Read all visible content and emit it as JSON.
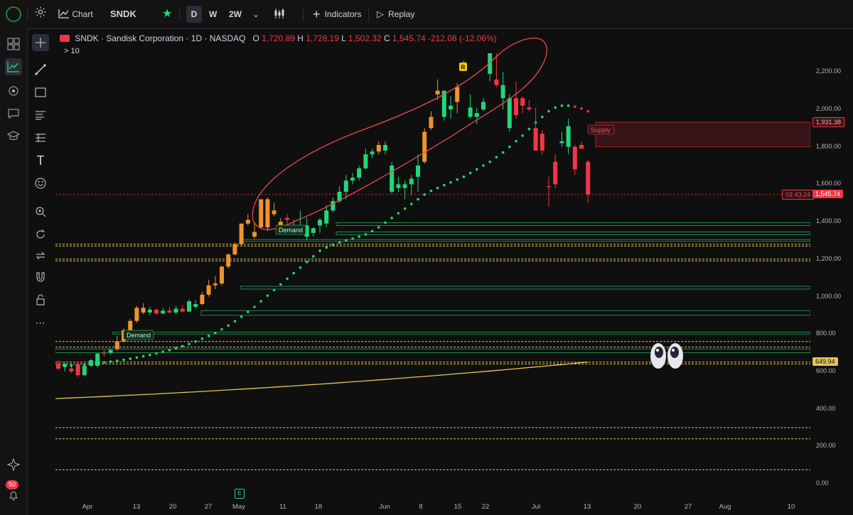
{
  "topbar": {
    "chart_label": "Chart",
    "symbol": "SNDK",
    "intervals": [
      "D",
      "W",
      "2W"
    ],
    "indicators_label": "Indicators",
    "replay_label": "Replay"
  },
  "legend": {
    "symbol": "SNDK",
    "name": "Sandisk Corporation · 1D · NASDAQ",
    "open_label": "O",
    "open": "1,720.89",
    "high_label": "H",
    "high": "1,728.19",
    "low_label": "L",
    "low": "1,502.32",
    "close_label": "C",
    "close": "1,545.74",
    "change": "-212.08 (-12.06%)",
    "indicators_collapsed": "> 10"
  },
  "left_toolbar": {
    "alerts_count": "50",
    "icons": [
      "layout-icon",
      "chart-icon",
      "crosshair-icon",
      "chat-icon",
      "academy-icon",
      "sparkle-icon"
    ]
  },
  "drawing_tools": [
    "cursor-icon",
    "trendline-icon",
    "rectangle-icon",
    "fib-icon",
    "pattern-icon",
    "text-icon",
    "emoji-icon",
    "zoom-icon",
    "reset-icon",
    "replay-icon",
    "magnet-icon",
    "lock-icon",
    "more-icon"
  ],
  "price_axis": {
    "ticks": [
      "2,200.00",
      "2,000.00",
      "1,800.00",
      "1,600.00",
      "1,400.00",
      "1,200.00",
      "1,000.00",
      "800.00",
      "600.00",
      "400.00",
      "200.00",
      "0.00"
    ],
    "tick_values": [
      2200,
      2000,
      1800,
      1600,
      1400,
      1200,
      1000,
      800,
      600,
      400,
      200,
      0
    ],
    "supply_level_label": "1,931.38",
    "countdown": "03:43:24",
    "last_price_label": "1,545.74",
    "ma_level_label": "649.94"
  },
  "time_axis": {
    "ticks": [
      "Apr",
      "13",
      "20",
      "27",
      "May",
      "11",
      "18",
      "Jun",
      "8",
      "15",
      "22",
      "Jul",
      "13",
      "20",
      "27",
      "Aug",
      "10"
    ]
  },
  "annotations": {
    "supply": "Supply",
    "demand_upper": "Demand",
    "demand_lower": "Demand",
    "r_marker": "R",
    "e_marker": "E"
  },
  "colors": {
    "up": "#22d67a",
    "down": "#f23645",
    "orange": "#f0932b",
    "ma": "#e6c45a",
    "zone": "#26a65b",
    "supply_fill": "#3a1418",
    "background": "#0f0f0f"
  },
  "chart_data": {
    "type": "candlestick",
    "ylim": [
      0,
      2300
    ],
    "supply_zone": [
      1800,
      1931.38
    ],
    "last_price": 1545.74,
    "ma_level": 649.94,
    "candles": [
      {
        "o": 640,
        "h": 660,
        "l": 605,
        "c": 615,
        "col": "down"
      },
      {
        "o": 625,
        "h": 650,
        "l": 600,
        "c": 640,
        "col": "up"
      },
      {
        "o": 615,
        "h": 625,
        "l": 590,
        "c": 600,
        "col": "down"
      },
      {
        "o": 640,
        "h": 650,
        "l": 570,
        "c": 580,
        "col": "down"
      },
      {
        "o": 580,
        "h": 640,
        "l": 575,
        "c": 630,
        "col": "up"
      },
      {
        "o": 630,
        "h": 665,
        "l": 625,
        "c": 660,
        "col": "up"
      },
      {
        "o": 630,
        "h": 700,
        "l": 620,
        "c": 695,
        "col": "up"
      },
      {
        "o": 695,
        "h": 715,
        "l": 680,
        "c": 700,
        "col": "down"
      },
      {
        "o": 700,
        "h": 720,
        "l": 690,
        "c": 715,
        "col": "up"
      },
      {
        "o": 720,
        "h": 790,
        "l": 710,
        "c": 760,
        "col": "orange"
      },
      {
        "o": 760,
        "h": 830,
        "l": 755,
        "c": 820,
        "col": "orange"
      },
      {
        "o": 820,
        "h": 880,
        "l": 810,
        "c": 870,
        "col": "orange"
      },
      {
        "o": 870,
        "h": 950,
        "l": 860,
        "c": 940,
        "col": "orange"
      },
      {
        "o": 940,
        "h": 965,
        "l": 905,
        "c": 915,
        "col": "orange"
      },
      {
        "o": 915,
        "h": 945,
        "l": 900,
        "c": 930,
        "col": "up"
      },
      {
        "o": 930,
        "h": 935,
        "l": 900,
        "c": 910,
        "col": "down"
      },
      {
        "o": 910,
        "h": 940,
        "l": 905,
        "c": 925,
        "col": "up"
      },
      {
        "o": 925,
        "h": 945,
        "l": 910,
        "c": 915,
        "col": "down"
      },
      {
        "o": 915,
        "h": 950,
        "l": 905,
        "c": 935,
        "col": "up"
      },
      {
        "o": 935,
        "h": 955,
        "l": 915,
        "c": 920,
        "col": "down"
      },
      {
        "o": 920,
        "h": 985,
        "l": 915,
        "c": 975,
        "col": "up"
      },
      {
        "o": 945,
        "h": 980,
        "l": 935,
        "c": 960,
        "col": "up"
      },
      {
        "o": 960,
        "h": 1025,
        "l": 955,
        "c": 1010,
        "col": "orange"
      },
      {
        "o": 1010,
        "h": 1090,
        "l": 1000,
        "c": 1060,
        "col": "orange"
      },
      {
        "o": 1060,
        "h": 1110,
        "l": 1040,
        "c": 1070,
        "col": "orange"
      },
      {
        "o": 1070,
        "h": 1165,
        "l": 1060,
        "c": 1160,
        "col": "orange"
      },
      {
        "o": 1160,
        "h": 1230,
        "l": 1150,
        "c": 1225,
        "col": "orange"
      },
      {
        "o": 1225,
        "h": 1290,
        "l": 1220,
        "c": 1280,
        "col": "orange"
      },
      {
        "o": 1280,
        "h": 1380,
        "l": 1270,
        "c": 1390,
        "col": "orange"
      },
      {
        "o": 1390,
        "h": 1440,
        "l": 1380,
        "c": 1410,
        "col": "orange"
      },
      {
        "o": 1345,
        "h": 1400,
        "l": 1310,
        "c": 1320,
        "col": "orange"
      },
      {
        "o": 1370,
        "h": 1480,
        "l": 1360,
        "c": 1520,
        "col": "orange"
      },
      {
        "o": 1520,
        "h": 1530,
        "l": 1350,
        "c": 1370,
        "col": "orange"
      },
      {
        "o": 1440,
        "h": 1500,
        "l": 1430,
        "c": 1460,
        "col": "orange"
      },
      {
        "o": 1400,
        "h": 1420,
        "l": 1360,
        "c": 1380,
        "col": "orange"
      },
      {
        "o": 1420,
        "h": 1440,
        "l": 1380,
        "c": 1410,
        "col": "down"
      },
      {
        "o": 1370,
        "h": 1410,
        "l": 1330,
        "c": 1345,
        "col": "up"
      },
      {
        "o": 1380,
        "h": 1460,
        "l": 1340,
        "c": 1355,
        "col": "up"
      },
      {
        "o": 1380,
        "h": 1420,
        "l": 1300,
        "c": 1320,
        "col": "up"
      },
      {
        "o": 1340,
        "h": 1370,
        "l": 1320,
        "c": 1365,
        "col": "up"
      },
      {
        "o": 1380,
        "h": 1420,
        "l": 1340,
        "c": 1410,
        "col": "up"
      },
      {
        "o": 1390,
        "h": 1490,
        "l": 1370,
        "c": 1460,
        "col": "up"
      },
      {
        "o": 1460,
        "h": 1530,
        "l": 1450,
        "c": 1510,
        "col": "up"
      },
      {
        "o": 1510,
        "h": 1590,
        "l": 1500,
        "c": 1560,
        "col": "up"
      },
      {
        "o": 1560,
        "h": 1650,
        "l": 1520,
        "c": 1620,
        "col": "up"
      },
      {
        "o": 1620,
        "h": 1660,
        "l": 1600,
        "c": 1635,
        "col": "up"
      },
      {
        "o": 1635,
        "h": 1700,
        "l": 1620,
        "c": 1685,
        "col": "up"
      },
      {
        "o": 1685,
        "h": 1790,
        "l": 1680,
        "c": 1760,
        "col": "up"
      },
      {
        "o": 1760,
        "h": 1790,
        "l": 1740,
        "c": 1775,
        "col": "up"
      },
      {
        "o": 1775,
        "h": 1830,
        "l": 1760,
        "c": 1810,
        "col": "orange"
      },
      {
        "o": 1810,
        "h": 1830,
        "l": 1760,
        "c": 1780,
        "col": "up"
      },
      {
        "o": 1560,
        "h": 1720,
        "l": 1550,
        "c": 1700,
        "col": "up"
      },
      {
        "o": 1600,
        "h": 1640,
        "l": 1560,
        "c": 1580,
        "col": "up"
      },
      {
        "o": 1580,
        "h": 1620,
        "l": 1520,
        "c": 1600,
        "col": "up"
      },
      {
        "o": 1600,
        "h": 1650,
        "l": 1540,
        "c": 1630,
        "col": "up"
      },
      {
        "o": 1640,
        "h": 1760,
        "l": 1560,
        "c": 1700,
        "col": "up"
      },
      {
        "o": 1720,
        "h": 1900,
        "l": 1710,
        "c": 1880,
        "col": "orange"
      },
      {
        "o": 1900,
        "h": 1990,
        "l": 1890,
        "c": 1960,
        "col": "orange"
      },
      {
        "o": 2080,
        "h": 2160,
        "l": 2050,
        "c": 2100,
        "col": "orange"
      },
      {
        "o": 1960,
        "h": 2100,
        "l": 1940,
        "c": 2100,
        "col": "up"
      },
      {
        "o": 2000,
        "h": 2070,
        "l": 1950,
        "c": 2020,
        "col": "up"
      },
      {
        "o": 2040,
        "h": 2140,
        "l": 1980,
        "c": 2120,
        "col": "orange"
      },
      {
        "o": 2240,
        "h": 2260,
        "l": 2210,
        "c": 2245,
        "col": "orange"
      },
      {
        "o": 2010,
        "h": 2080,
        "l": 1950,
        "c": 1960,
        "col": "up"
      },
      {
        "o": 1980,
        "h": 2010,
        "l": 1920,
        "c": 1960,
        "col": "up"
      },
      {
        "o": 2000,
        "h": 2060,
        "l": 1990,
        "c": 2040,
        "col": "up"
      },
      {
        "o": 2190,
        "h": 2300,
        "l": 2150,
        "c": 2300,
        "col": "up"
      },
      {
        "o": 2160,
        "h": 2300,
        "l": 2120,
        "c": 2130,
        "col": "down"
      },
      {
        "o": 2130,
        "h": 2200,
        "l": 2000,
        "c": 2060,
        "col": "up"
      },
      {
        "o": 1900,
        "h": 2080,
        "l": 1880,
        "c": 2060,
        "col": "up"
      },
      {
        "o": 2060,
        "h": 2150,
        "l": 1950,
        "c": 1970,
        "col": "down"
      },
      {
        "o": 2060,
        "h": 2070,
        "l": 1980,
        "c": 2020,
        "col": "down"
      },
      {
        "o": 2000,
        "h": 2050,
        "l": 1990,
        "c": 2010,
        "col": "down"
      },
      {
        "o": 1900,
        "h": 2010,
        "l": 1780,
        "c": 1780,
        "col": "down"
      },
      {
        "o": 1870,
        "h": 1890,
        "l": 1760,
        "c": 1780,
        "col": "down"
      },
      {
        "o": 1590,
        "h": 1640,
        "l": 1480,
        "c": 1590,
        "col": "down"
      },
      {
        "o": 1720,
        "h": 1760,
        "l": 1580,
        "c": 1600,
        "col": "down"
      },
      {
        "o": 1820,
        "h": 1880,
        "l": 1800,
        "c": 1830,
        "col": "up"
      },
      {
        "o": 1800,
        "h": 1950,
        "l": 1760,
        "c": 1910,
        "col": "up"
      },
      {
        "o": 1800,
        "h": 1810,
        "l": 1650,
        "c": 1680,
        "col": "down"
      },
      {
        "o": 1810,
        "h": 1830,
        "l": 1790,
        "c": 1790,
        "col": "down"
      },
      {
        "o": 1720,
        "h": 1730,
        "l": 1500,
        "c": 1545,
        "col": "down"
      }
    ],
    "psar": [
      625,
      628,
      631,
      634,
      637,
      640,
      644,
      648,
      652,
      657,
      662,
      668,
      674,
      681,
      688,
      696,
      705,
      714,
      724,
      735,
      747,
      760,
      775,
      790,
      805,
      825,
      845,
      868,
      892,
      918,
      945,
      975,
      1005,
      1035,
      1065,
      1095,
      1125,
      1155,
      1185,
      1215,
      1245,
      1262,
      1278,
      1290,
      1300,
      1310,
      1320,
      1332,
      1350,
      1370,
      1395,
      1420,
      1445,
      1470,
      1495,
      1520,
      1545,
      1565,
      1580,
      1595,
      1610,
      1625,
      1640,
      1660,
      1680,
      1700,
      1720,
      1745,
      1770,
      1800,
      1830,
      1860,
      1895,
      1930,
      1960,
      1990,
      2010,
      2020,
      2020,
      2015,
      2005,
      1990,
      1975,
      1960,
      1945,
      1930
    ],
    "psar_red_start": 79,
    "ma_start": 455,
    "ma_end": 650,
    "zones": [
      {
        "lo": 1380,
        "hi": 1395
      },
      {
        "lo": 1330,
        "hi": 1345
      },
      {
        "lo": 1295,
        "hi": 1305
      },
      {
        "lo": 1040,
        "hi": 1055
      },
      {
        "lo": 900,
        "hi": 925
      },
      {
        "lo": 800,
        "hi": 810
      },
      {
        "lo": 700,
        "hi": 720
      }
    ],
    "dashed_levels": [
      1280,
      1270,
      1200,
      1190,
      760,
      730,
      650,
      640,
      300,
      240,
      75
    ]
  }
}
